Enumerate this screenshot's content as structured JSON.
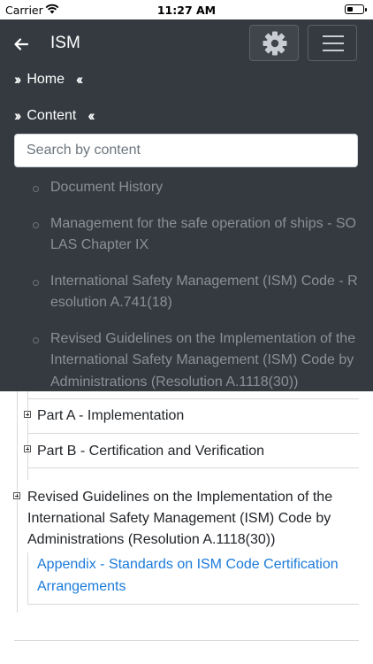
{
  "status_bar": {
    "carrier": "Carrier",
    "time": "11:27 AM"
  },
  "nav": {
    "title": "ISM",
    "back_icon": "arrow-left-icon",
    "settings_icon": "gear-icon",
    "menu_icon": "hamburger-icon"
  },
  "menu": {
    "home_label": "Home",
    "content_label": "Content",
    "search_placeholder": "Search by content",
    "toc_items": [
      "Document History",
      "Management for the safe operation of ships - SOLAS Chapter IX",
      "International Safety Management (ISM) Code - Resolution A.741(18)",
      "Revised Guidelines on the Implementation of the International Safety Management (ISM) Code by Administrations (Resolution A.1118(30))"
    ]
  },
  "tree": {
    "part_a": "Part A - Implementation",
    "part_b": "Part B - Certification and Verification",
    "revised": "Revised Guidelines on the Implementation of the International Safety Management (ISM) Code by Administrations (Resolution A.1118(30))",
    "appendix_link": "Appendix - Standards on ISM Code Certification Arrangements"
  },
  "colors": {
    "overlay": "#343a40",
    "link": "#1a7ad9"
  }
}
